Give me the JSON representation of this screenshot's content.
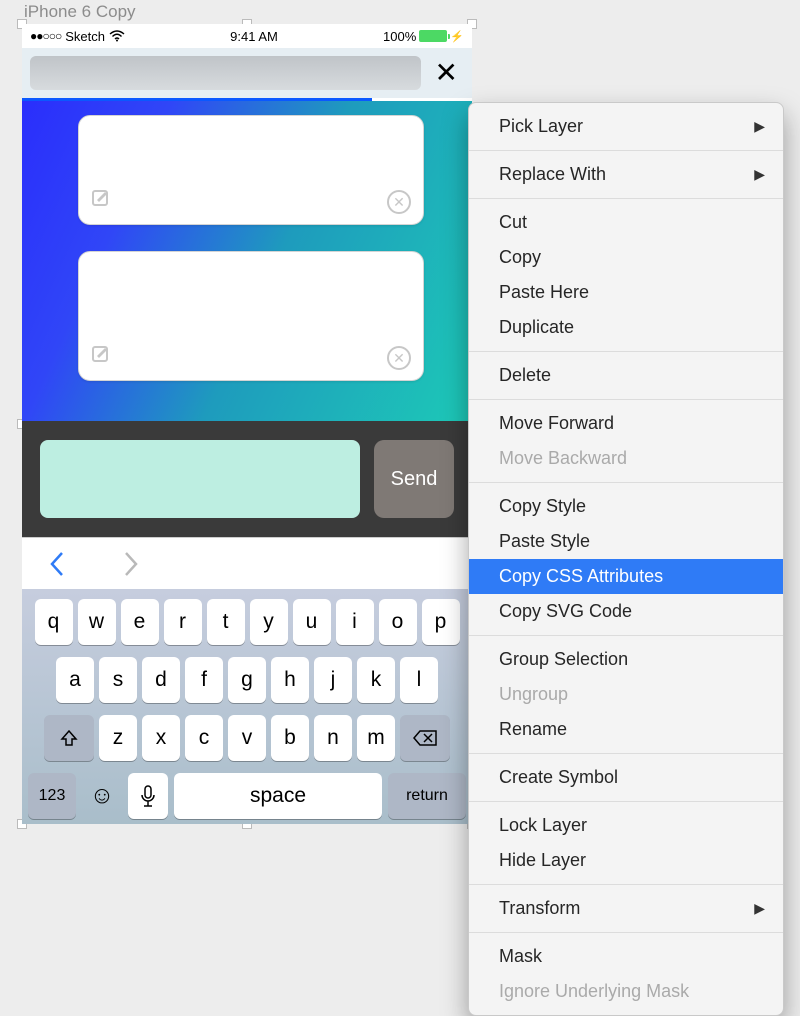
{
  "artboard_label": "iPhone 6 Copy",
  "statusbar": {
    "carrier": "Sketch",
    "time": "9:41 AM",
    "battery_pct": "100%"
  },
  "compose": {
    "send": "Send"
  },
  "keyboard": {
    "row1": [
      "q",
      "w",
      "e",
      "r",
      "t",
      "y",
      "u",
      "i",
      "o",
      "p"
    ],
    "row2": [
      "a",
      "s",
      "d",
      "f",
      "g",
      "h",
      "j",
      "k",
      "l"
    ],
    "row3": [
      "z",
      "x",
      "c",
      "v",
      "b",
      "n",
      "m"
    ],
    "num": "123",
    "space": "space",
    "return": "return"
  },
  "context_menu": {
    "pick": "Pick Layer",
    "replace": "Replace With",
    "cut": "Cut",
    "copy": "Copy",
    "paste_here": "Paste Here",
    "duplicate": "Duplicate",
    "delete": "Delete",
    "fwd": "Move Forward",
    "bwd": "Move Backward",
    "copy_style": "Copy Style",
    "paste_style": "Paste Style",
    "copy_css": "Copy CSS Attributes",
    "copy_svg": "Copy SVG Code",
    "group": "Group Selection",
    "ungroup": "Ungroup",
    "rename": "Rename",
    "create_symbol": "Create Symbol",
    "lock": "Lock Layer",
    "hide": "Hide Layer",
    "transform": "Transform",
    "mask": "Mask",
    "ignore_mask": "Ignore Underlying Mask"
  }
}
